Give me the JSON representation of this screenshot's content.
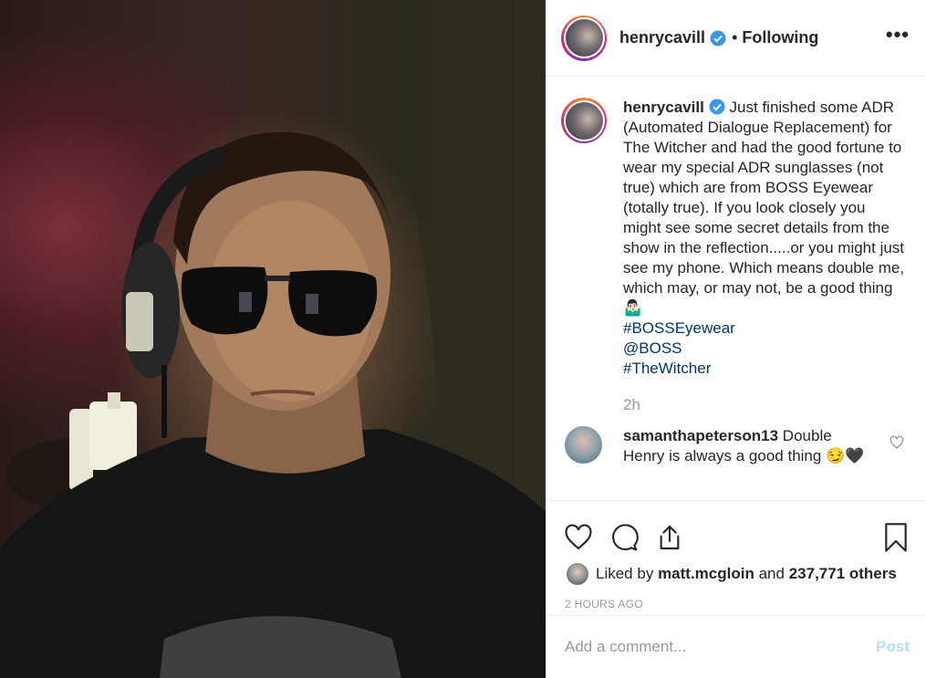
{
  "post": {
    "username": "henrycavill",
    "verified_icon": "verified-badge-icon",
    "separator": "•",
    "follow_state": "Following",
    "more_icon": "•••",
    "caption": {
      "username": "henrycavill",
      "text": " Just finished some ADR (Automated Dialogue Replacement) for The Witcher and had the good fortune to wear my special ADR sunglasses (not true) which are from BOSS Eyewear (totally true). If you look closely you might see some secret details from the show in the reflection.....or you might just see my phone. Which means double me, which may, or may not, be a good thing 🤷🏻‍♂️",
      "tags": [
        "#BOSSEyewear",
        "@BOSS",
        "#TheWitcher"
      ],
      "age": "2h"
    },
    "comments": [
      {
        "username": "samanthapeterson13",
        "text": " Double Henry is always a good thing 😏🖤"
      }
    ],
    "likes": {
      "prefix": "Liked by ",
      "user": "matt.mcgloin",
      "middle": " and ",
      "others": "237,771 others"
    },
    "timestamp": "2 HOURS AGO",
    "add_comment": {
      "placeholder": "Add a comment...",
      "post_label": "Post"
    },
    "colors": {
      "link": "#003569",
      "post_disabled": "#b2dffc",
      "verified": "#3897f0"
    }
  }
}
